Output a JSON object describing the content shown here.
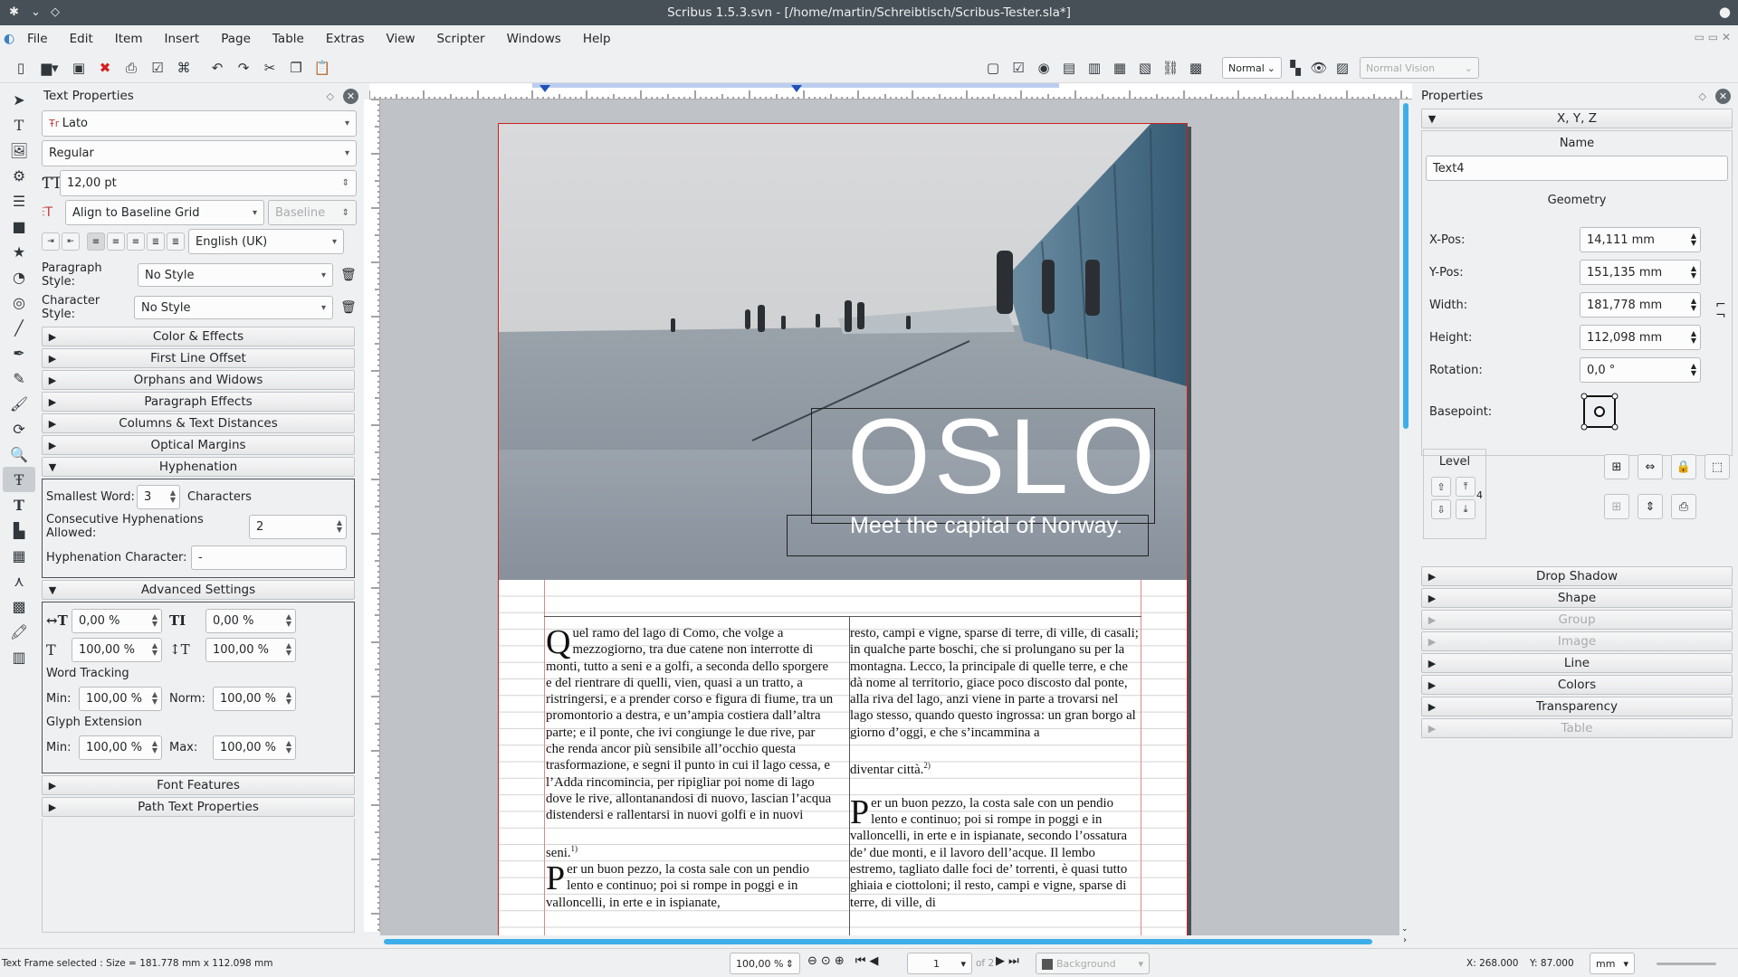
{
  "window": {
    "title": "Scribus 1.5.3.svn - [/home/martin/Schreibtisch/Scribus-Tester.sla*]"
  },
  "menu": [
    "File",
    "Edit",
    "Item",
    "Insert",
    "Page",
    "Table",
    "Extras",
    "View",
    "Scripter",
    "Windows",
    "Help"
  ],
  "toolbar": {
    "view_mode": "Normal",
    "vision_mode": "Normal Vision"
  },
  "text_properties": {
    "title": "Text Properties",
    "font_family": "Lato",
    "font_style": "Regular",
    "font_size": "12,00 pt",
    "baseline_mode": "Align to Baseline Grid",
    "baseline_value": "Baseline",
    "language": "English (UK)",
    "paragraph_style_label": "Paragraph Style:",
    "paragraph_style": "No Style",
    "character_style_label": "Character Style:",
    "character_style": "No Style",
    "sections_top": [
      "Color & Effects",
      "First Line Offset",
      "Orphans and Widows",
      "Paragraph Effects",
      "Columns & Text Distances",
      "Optical Margins"
    ],
    "hyphenation": {
      "title": "Hyphenation",
      "smallest_word_label": "Smallest Word:",
      "smallest_word": "3",
      "smallest_word_unit": "Characters",
      "consecutive_label": "Consecutive Hyphenations Allowed:",
      "consecutive": "2",
      "char_label": "Hyphenation Character:",
      "char": "-"
    },
    "advanced": {
      "title": "Advanced Settings",
      "kerning": "0,00 %",
      "baseline_offset": "0,00 %",
      "scale_v": "100,00 %",
      "scale_h": "100,00 %",
      "word_tracking_label": "Word Tracking",
      "min_label": "Min:",
      "norm_label": "Norm:",
      "max_label": "Max:",
      "wt_min": "100,00 %",
      "wt_norm": "100,00 %",
      "glyph_label": "Glyph Extension",
      "ge_min": "100,00 %",
      "ge_max": "100,00 %"
    },
    "sections_bottom": [
      "Font Features",
      "Path Text Properties"
    ]
  },
  "document": {
    "headline": "OSLO",
    "subline": "Meet the capital of Norway.",
    "col1_p1_cap": "Q",
    "col1_p1": "uel ramo del lago di Como, che volge a mezzogiorno, tra due catene non interrotte di monti, tutto a seni e a golfi, a seconda dello sporgere e del rientrare di quelli, vien, quasi a un tratto, a ristringersi, e a prender corso e figura di fiume, tra un promontorio a destra, e un’ampia costiera dall’altra parte; e il ponte, che ivi congiunge le due rive, par che renda ancor più sensibile all’occhio questa trasformazione, e segni il punto in cui il lago cessa, e l’Adda rincomincia, per ripigliar poi nome di lago dove le rive, allontanandosi di nuovo, lascian l’acqua distendersi e rallentarsi in nuovi golfi e in nuovi",
    "col1_p1_end": "seni.",
    "fn1": "1)",
    "col1_p2_cap": "P",
    "col1_p2": "er un buon pezzo, la costa sale con un pendio lento e continuo; poi si rompe in poggi e in valloncelli, in erte e in ispianate,",
    "col2_p1": "resto, campi e vigne, sparse di terre, di ville, di casali; in qualche parte boschi, che si prolungano su per la montagna. Lecco, la principale di quelle terre, e che dà nome al territorio, giace poco discosto dal ponte, alla riva del lago, anzi viene in parte a trovarsi nel lago stesso, quando questo ingrossa: un gran borgo al giorno d’oggi, e che s’incammina a",
    "col2_p1_end": "diventar città.",
    "fn2": "2)",
    "col2_p2_cap": "P",
    "col2_p2": "er un buon pezzo, la costa sale con un pendio lento e continuo; poi si rompe in poggi e in valloncelli, in erte e in ispianate, secondo l’ossatura de’ due monti, e il lavoro dell’acque. Il lembo estremo, tagliato dalle foci de’ torrenti, è quasi tutto ghiaia e ciottoloni; il resto, campi e vigne, sparse di terre, di ville, di"
  },
  "properties": {
    "title": "Properties",
    "xyz": "X, Y, Z",
    "name_label": "Name",
    "name": "Text4",
    "geometry": "Geometry",
    "xpos_label": "X-Pos:",
    "xpos": "14,111 mm",
    "ypos_label": "Y-Pos:",
    "ypos": "151,135 mm",
    "width_label": "Width:",
    "width": "181,778 mm",
    "height_label": "Height:",
    "height": "112,098 mm",
    "rotation_label": "Rotation:",
    "rotation": "0,0 °",
    "basepoint_label": "Basepoint:",
    "level_label": "Level",
    "level": "4",
    "sections": [
      {
        "label": "Drop Shadow",
        "enabled": true
      },
      {
        "label": "Shape",
        "enabled": true
      },
      {
        "label": "Group",
        "enabled": false
      },
      {
        "label": "Image",
        "enabled": false
      },
      {
        "label": "Line",
        "enabled": true
      },
      {
        "label": "Colors",
        "enabled": true
      },
      {
        "label": "Transparency",
        "enabled": true
      },
      {
        "label": "Table",
        "enabled": false
      }
    ]
  },
  "status": {
    "message": "Text Frame selected : Size = 181.778 mm x 112.098 mm",
    "zoom": "100,00 %",
    "page": "1",
    "page_of": "of 2",
    "layer": "Background",
    "x": "X:  268.000",
    "y": "Y:  87.000",
    "unit": "mm"
  }
}
